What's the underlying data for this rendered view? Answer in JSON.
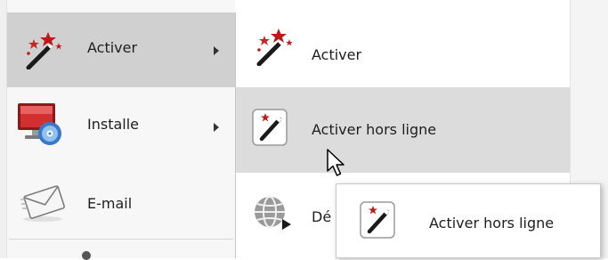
{
  "main_menu": {
    "items": [
      {
        "label": "Activer",
        "icon": "magic-wand-icon",
        "has_submenu": true
      },
      {
        "label": "Installe",
        "icon": "monitor-disc-icon",
        "has_submenu": true
      },
      {
        "label": "E-mail",
        "icon": "envelope-icon",
        "has_submenu": false
      }
    ]
  },
  "sub_menu": {
    "items": [
      {
        "label": "Activer",
        "icon": "magic-wand-icon"
      },
      {
        "label": "Activer hors ligne",
        "icon": "magic-wand-offline-icon"
      },
      {
        "label": "Dé",
        "icon": "globe-icon"
      }
    ]
  },
  "tooltip": {
    "label": "Activer hors ligne",
    "icon": "magic-wand-offline-icon"
  },
  "colors": {
    "hover_main": "#d0d0d0",
    "hover_sub": "#dcdcdc",
    "star_red": "#c01818"
  }
}
